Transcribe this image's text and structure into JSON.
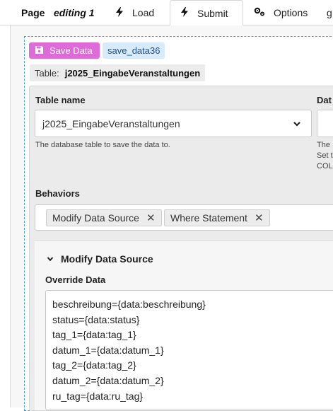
{
  "topbar": {
    "page_label": "Page",
    "editing_label": "editing 1",
    "tabs": [
      {
        "label": "Load",
        "icon": "bolt-icon"
      },
      {
        "label": "Submit",
        "icon": "bolt-icon"
      },
      {
        "label": "Options",
        "icon": "gears-icon"
      },
      {
        "label": "g"
      }
    ]
  },
  "action": {
    "save_label": "Save Data",
    "id_badge": "save_data36"
  },
  "table_info": {
    "label": "Table:",
    "value": "j2025_EingabeVeranstaltungen"
  },
  "table_name": {
    "label": "Table name",
    "value": "j2025_EingabeVeranstaltungen",
    "help": "The database table to save the data to."
  },
  "data_col": {
    "label": "Dat",
    "help_lines": [
      "The",
      "Set t",
      "COL"
    ]
  },
  "behaviors": {
    "label": "Behaviors",
    "chips": [
      "Modify Data Source",
      "Where Statement"
    ]
  },
  "modify_section": {
    "title": "Modify Data Source",
    "override_label": "Override Data",
    "lines": [
      "beschreibung={data:beschreibung}",
      "status={data:status}",
      "tag_1={data:tag_1}",
      "datum_1={data:datum_1}",
      "tag_2={data:tag_2}",
      "datum_2={data:datum_2}",
      "ru_tag={data:ru_tag}"
    ]
  },
  "colors": {
    "save_button": "#dd6cd8",
    "id_badge_bg": "#d7ebfb",
    "dashed_border": "#4aa3d8"
  }
}
